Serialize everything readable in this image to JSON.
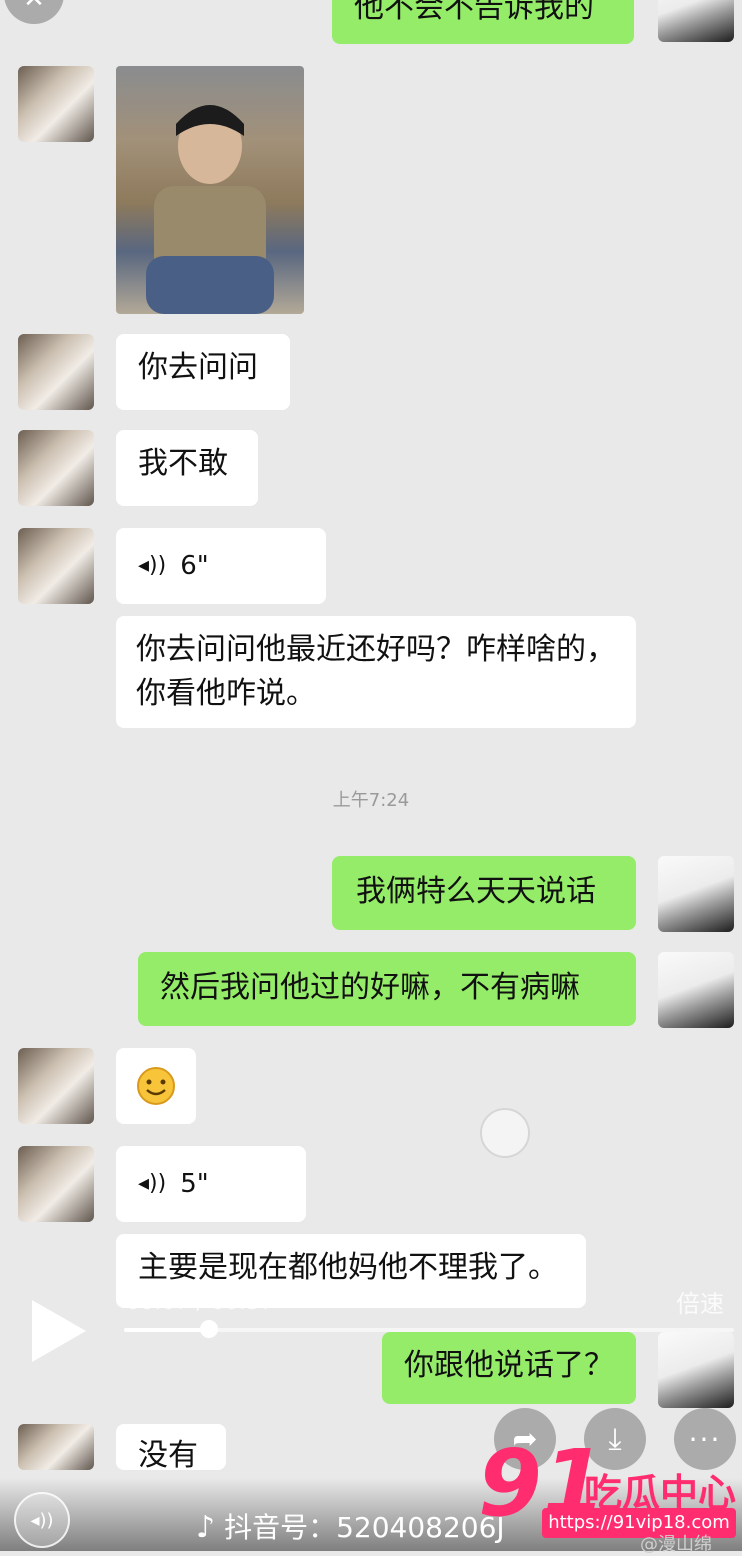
{
  "top_partial_message": "他不会不告诉我的",
  "messages": {
    "m1": "你去问问",
    "m2": "我不敢",
    "voice1_duration": "6\"",
    "m3": "你去问问他最近还好吗？咋样啥的，你看他咋说。",
    "timestamp": "上午7:24",
    "m4": "我俩特么天天说话",
    "m5": "然后我问他过的好嘛，不有病嘛",
    "voice2_duration": "5\"",
    "m6": "主要是现在都他妈他不理我了。",
    "m7": "你跟他说话了？",
    "m8_partial": "没有"
  },
  "player": {
    "time": "00:07 / 00:57",
    "progress": 0.14,
    "speed_label": "倍速"
  },
  "footer": {
    "tiktok_id": "抖音号：520408206J"
  },
  "watermark": {
    "logo": "91",
    "text": "吃瓜中心",
    "url": "https://91vip18.com",
    "weibo": "@漫山绵"
  },
  "colors": {
    "sent_bubble": "#95ec69",
    "received_bubble": "#ffffff",
    "background": "#e9e9e9",
    "watermark": "#ff2d6f"
  },
  "icons": [
    "close-icon",
    "voice-icon",
    "emoji-smile-icon",
    "play-icon",
    "share-icon",
    "download-icon",
    "more-icon",
    "audio-icon",
    "tiktok-icon"
  ]
}
